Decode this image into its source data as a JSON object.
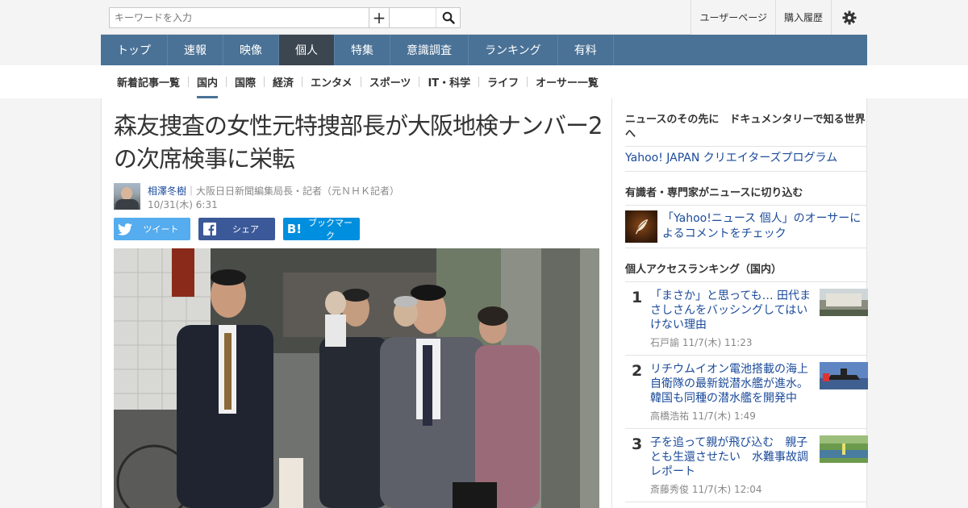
{
  "search": {
    "placeholder": "キーワードを入力"
  },
  "top_links": {
    "user_page": "ユーザーページ",
    "purchase_history": "購入履歴"
  },
  "nav": [
    "トップ",
    "速報",
    "映像",
    "個人",
    "特集",
    "意識調査",
    "ランキング",
    "有料"
  ],
  "nav_active": "個人",
  "subnav": [
    "新着記事一覧",
    "国内",
    "国際",
    "経済",
    "エンタメ",
    "スポーツ",
    "IT・科学",
    "ライフ",
    "オーサー一覧"
  ],
  "subnav_active": "国内",
  "article": {
    "title": "森友捜査の女性元特捜部長が大阪地検ナンバー2の次席検事に栄転",
    "author_name": "相澤冬樹",
    "author_title": "｜大阪日日新聞編集局長・記者（元ＮＨＫ記者）",
    "date": "10/31(木) 6:31"
  },
  "share": {
    "tweet": "ツイート",
    "share": "シェア",
    "bookmark": "ブックマーク",
    "bookmark_mark": "B!"
  },
  "sidebar": {
    "doc_heading": "ニュースのその先に　ドキュメンタリーで知る世界へ",
    "doc_link": "Yahoo! JAPAN クリエイターズプログラム",
    "expert_heading": "有識者・専門家がニュースに切り込む",
    "expert_link": "「Yahoo!ニュース 個人」のオーサーによるコメントをチェック",
    "ranking_heading": "個人アクセスランキング（国内）",
    "ranking": [
      {
        "rank": "1",
        "title": "「まさか」と思っても… 田代まさしさんをバッシングしてはいけない理由",
        "author": "石戸諭",
        "date": "11/7(木) 11:23"
      },
      {
        "rank": "2",
        "title": "リチウムイオン電池搭載の海上自衛隊の最新鋭潜水艦が進水。韓国も同種の潜水艦を開発中",
        "author": "高橋浩祐",
        "date": "11/7(木) 1:49"
      },
      {
        "rank": "3",
        "title": "子を追って親が飛び込む　親子とも生還させたい　水難事故調レポート",
        "author": "斎藤秀俊",
        "date": "11/7(木) 12:04"
      }
    ]
  },
  "colors": {
    "nav_bg": "#4a7296",
    "nav_active": "#3c4650",
    "link": "#1a4a9a",
    "twitter": "#55acee",
    "facebook": "#3b5998",
    "hatena": "#008fde"
  }
}
